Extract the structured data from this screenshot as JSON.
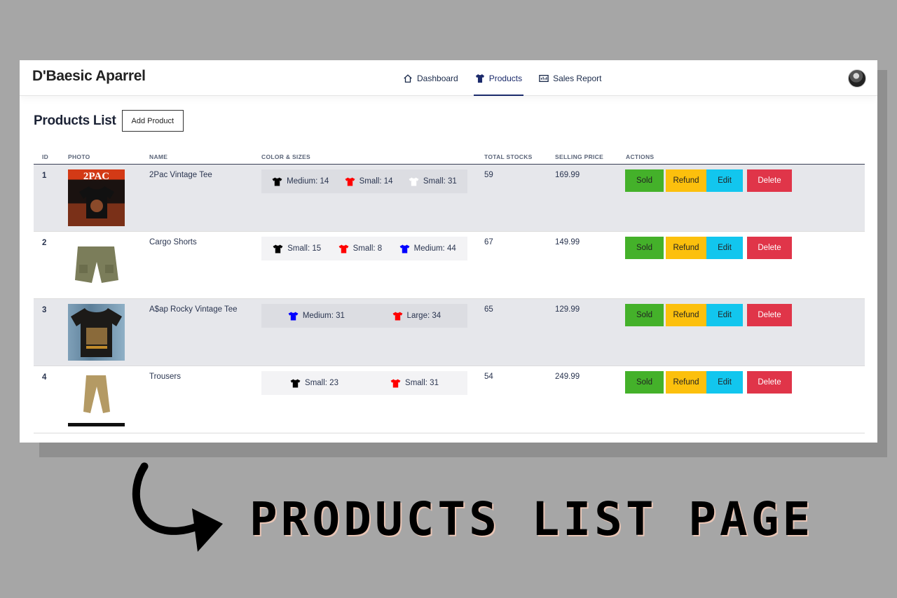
{
  "brand": "D'Baesic Aparrel",
  "nav": [
    {
      "label": "Dashboard",
      "icon": "home-icon",
      "active": false
    },
    {
      "label": "Products",
      "icon": "tshirt-icon",
      "active": true
    },
    {
      "label": "Sales Report",
      "icon": "report-icon",
      "active": false
    }
  ],
  "page": {
    "title": "Products List",
    "add_button": "Add Product"
  },
  "columns": [
    "ID",
    "PHOTO",
    "NAME",
    "COLOR & SIZES",
    "TOTAL STOCKS",
    "SELLING PRICE",
    "ACTIONS"
  ],
  "actions": {
    "sold": "Sold",
    "refund": "Refund",
    "edit": "Edit",
    "delete": "Delete"
  },
  "colors": {
    "sold": "#44b12a",
    "refund": "#fcc00d",
    "edit": "#12c6ee",
    "delete": "#e03549",
    "nav_accent": "#1b2a6b"
  },
  "products": [
    {
      "id": "1",
      "name": "2Pac Vintage Tee",
      "photo": "2pac-tee-photo",
      "stock": "59",
      "price": "169.99",
      "sizes": [
        {
          "color": "#000000",
          "text": "Medium: 14"
        },
        {
          "color": "#ff0000",
          "text": "Small: 14"
        },
        {
          "color": "#ffffff",
          "text": "Small: 31"
        }
      ]
    },
    {
      "id": "2",
      "name": "Cargo Shorts",
      "photo": "cargo-shorts-photo",
      "stock": "67",
      "price": "149.99",
      "sizes": [
        {
          "color": "#000000",
          "text": "Small: 15"
        },
        {
          "color": "#ff0000",
          "text": "Small: 8"
        },
        {
          "color": "#0000ff",
          "text": "Medium: 44"
        }
      ]
    },
    {
      "id": "3",
      "name": "A$ap Rocky Vintage Tee",
      "photo": "asap-tee-photo",
      "stock": "65",
      "price": "129.99",
      "sizes": [
        {
          "color": "#0000ff",
          "text": "Medium: 31"
        },
        {
          "color": "#ff0000",
          "text": "Large: 34"
        }
      ]
    },
    {
      "id": "4",
      "name": "Trousers",
      "photo": "trousers-photo",
      "stock": "54",
      "price": "249.99",
      "sizes": [
        {
          "color": "#000000",
          "text": "Small: 23"
        },
        {
          "color": "#ff0000",
          "text": "Small: 31"
        }
      ]
    }
  ],
  "caption": "PRODUCTS LIST PAGE"
}
